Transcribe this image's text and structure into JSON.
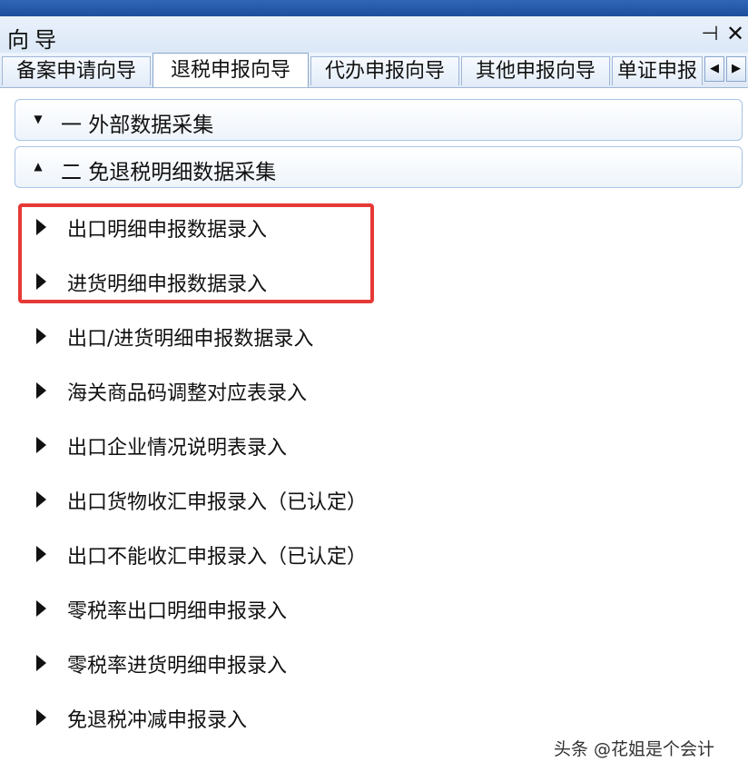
{
  "panel": {
    "title": "向导"
  },
  "tabs": [
    {
      "label": "备案申请向导"
    },
    {
      "label": "退税申报向导"
    },
    {
      "label": "代办申报向导"
    },
    {
      "label": "其他申报向导"
    },
    {
      "label": "单证申报"
    }
  ],
  "tab_scroll": {
    "left": "◀",
    "right": "▶"
  },
  "groups": [
    {
      "chevron": "▼",
      "label": "一  外部数据采集"
    },
    {
      "chevron": "▲",
      "label": "二  免退税明细数据采集"
    }
  ],
  "items": [
    {
      "label": "出口明细申报数据录入"
    },
    {
      "label": "进货明细申报数据录入"
    },
    {
      "label": "出口/进货明细申报数据录入"
    },
    {
      "label": "海关商品码调整对应表录入"
    },
    {
      "label": "出口企业情况说明表录入"
    },
    {
      "label": "出口货物收汇申报录入（已认定）"
    },
    {
      "label": "出口不能收汇申报录入（已认定）"
    },
    {
      "label": "零税率出口明细申报录入"
    },
    {
      "label": "零税率进货明细申报录入"
    },
    {
      "label": "免退税冲减申报录入"
    }
  ],
  "icons": {
    "pin": "⊣",
    "close": "✕"
  },
  "watermark": "头条 @花姐是个会计"
}
